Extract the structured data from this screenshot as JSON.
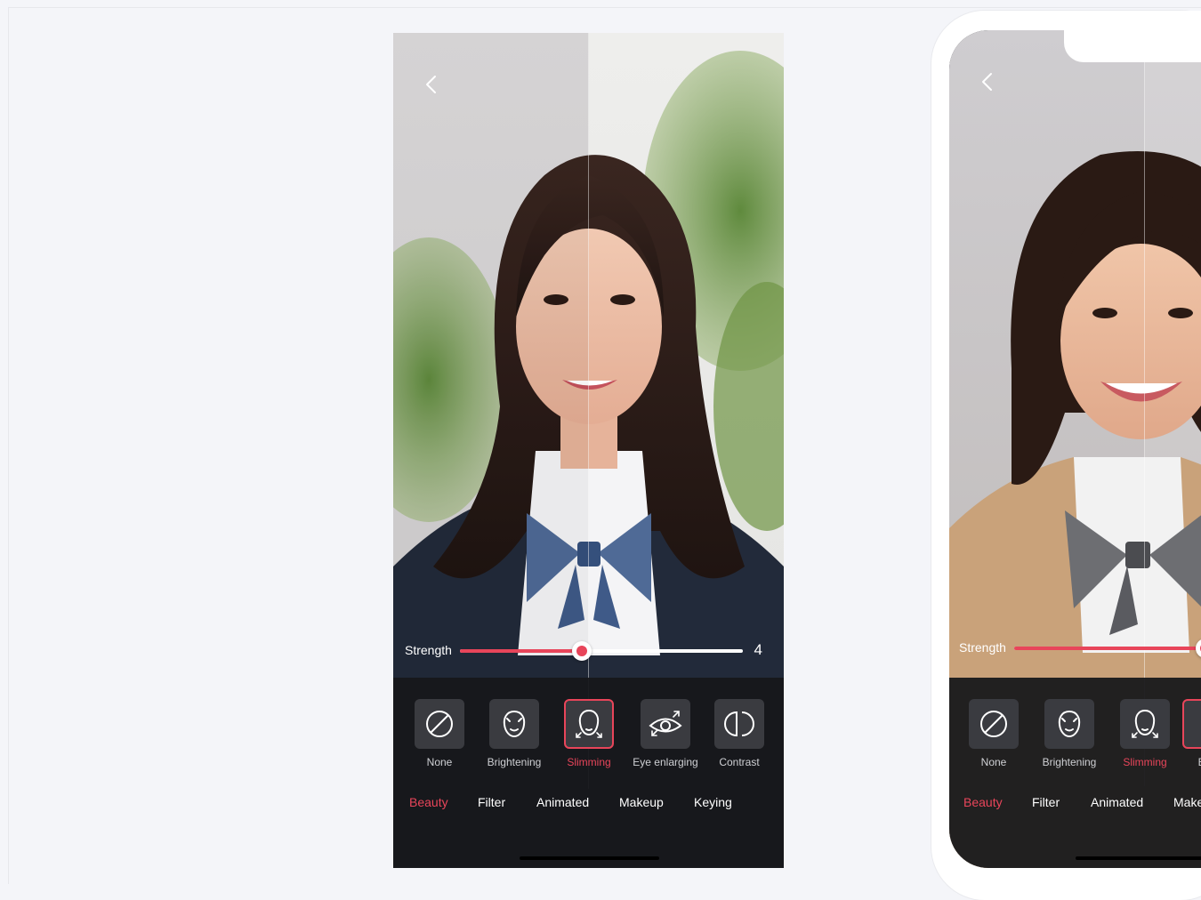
{
  "colors": {
    "accent": "#e8455a",
    "panel": "#16171b",
    "page_bg": "#f4f5f9"
  },
  "phone1": {
    "back_icon": "chevron-left-icon",
    "strength": {
      "label": "Strength",
      "value": "4",
      "fraction": 0.43
    },
    "tools": [
      {
        "label": "None",
        "icon": "none-icon",
        "active": false
      },
      {
        "label": "Brightening",
        "icon": "face-brightening-icon",
        "active": false
      },
      {
        "label": "Slimming",
        "icon": "face-slimming-icon",
        "active": true
      },
      {
        "label": "Eye enlarging",
        "icon": "eye-enlarging-icon",
        "active": false
      },
      {
        "label": "Contrast",
        "icon": "contrast-icon",
        "active": false
      }
    ],
    "tabs": [
      {
        "label": "Beauty",
        "active": true
      },
      {
        "label": "Filter",
        "active": false
      },
      {
        "label": "Animated",
        "active": false
      },
      {
        "label": "Makeup",
        "active": false
      },
      {
        "label": "Keying",
        "active": false
      }
    ]
  },
  "phone2": {
    "back_icon": "chevron-left-icon",
    "strength": {
      "label": "Strength",
      "fraction": 0.58
    },
    "tools": [
      {
        "label": "None",
        "icon": "none-icon",
        "active": false
      },
      {
        "label": "Brightening",
        "icon": "face-brightening-icon",
        "active": false
      },
      {
        "label": "Slimming",
        "icon": "face-slimming-icon",
        "active": true
      },
      {
        "label": "Eye",
        "icon": "eye-enlarging-icon",
        "active": false
      }
    ],
    "tabs": [
      {
        "label": "Beauty",
        "active": true
      },
      {
        "label": "Filter",
        "active": false
      },
      {
        "label": "Animated",
        "active": false
      },
      {
        "label": "Make",
        "active": false
      }
    ]
  }
}
